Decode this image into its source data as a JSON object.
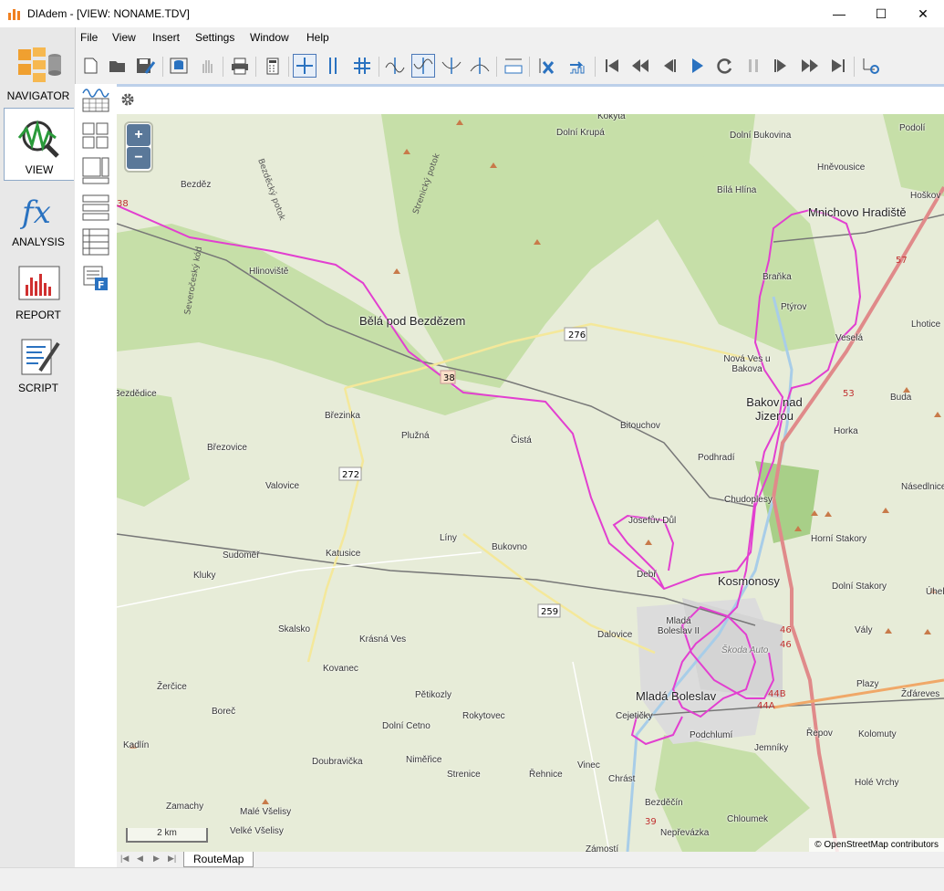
{
  "window": {
    "title": "DIAdem - [VIEW:  NONAME.TDV]",
    "minimize": "—",
    "maximize": "☐",
    "close": "✕"
  },
  "nav": [
    {
      "label": "NAVIGATOR",
      "icon": "navigator-icon"
    },
    {
      "label": "VIEW",
      "icon": "view-icon"
    },
    {
      "label": "ANALYSIS",
      "icon": "analysis-icon"
    },
    {
      "label": "REPORT",
      "icon": "report-icon"
    },
    {
      "label": "SCRIPT",
      "icon": "script-icon"
    }
  ],
  "menu": [
    "File",
    "View",
    "Insert",
    "Settings",
    "Window",
    "Help"
  ],
  "map": {
    "zoom_in": "+",
    "zoom_out": "−",
    "scale": "2 km",
    "attribution": "© OpenStreetMap contributors",
    "places": [
      {
        "name": "Kokyta"
      },
      {
        "name": "Dolní Krupá"
      },
      {
        "name": "Dolní Bukovina"
      },
      {
        "name": "Podolí"
      },
      {
        "name": "Hněvousice"
      },
      {
        "name": "Hoškov"
      },
      {
        "name": "Bílá Hlína"
      },
      {
        "name": "Bezděz"
      },
      {
        "name": "Mnichovo Hradiště"
      },
      {
        "name": "Hlinoviště"
      },
      {
        "name": "Braňka"
      },
      {
        "name": "Ptýrov"
      },
      {
        "name": "Bělá pod Bezdězem"
      },
      {
        "name": "Lhotice"
      },
      {
        "name": "Veselá"
      },
      {
        "name": "Nová Ves u Bakova"
      },
      {
        "name": "Bakov nad Jizerou"
      },
      {
        "name": "Buda"
      },
      {
        "name": "Bezdědice"
      },
      {
        "name": "Březinka"
      },
      {
        "name": "Bitouchov"
      },
      {
        "name": "Horka"
      },
      {
        "name": "Plužná"
      },
      {
        "name": "Čistá"
      },
      {
        "name": "Březovice"
      },
      {
        "name": "Podhradí"
      },
      {
        "name": "Valovice"
      },
      {
        "name": "Chudoplesy"
      },
      {
        "name": "Násedlnice"
      },
      {
        "name": "Josefův Důl"
      },
      {
        "name": "Líny"
      },
      {
        "name": "Horní Stakory"
      },
      {
        "name": "Sudoměř"
      },
      {
        "name": "Katusice"
      },
      {
        "name": "Bukovno"
      },
      {
        "name": "Kluky"
      },
      {
        "name": "Debř"
      },
      {
        "name": "Kosmonosy"
      },
      {
        "name": "Dolní Stakory"
      },
      {
        "name": "Úhel"
      },
      {
        "name": "Mladá Boleslav II"
      },
      {
        "name": "Dalovice"
      },
      {
        "name": "Skalsko"
      },
      {
        "name": "Škoda Auto"
      },
      {
        "name": "Vály"
      },
      {
        "name": "Krásná Ves"
      },
      {
        "name": "Kovanec"
      },
      {
        "name": "Plazy"
      },
      {
        "name": "Žerčice"
      },
      {
        "name": "Pětikozly"
      },
      {
        "name": "Mladá Boleslav"
      },
      {
        "name": "Žďáreves"
      },
      {
        "name": "Boreč"
      },
      {
        "name": "Rokytovec"
      },
      {
        "name": "Cejetičky"
      },
      {
        "name": "Podchlumí"
      },
      {
        "name": "Řepov"
      },
      {
        "name": "Kolomuty"
      },
      {
        "name": "Kadlín"
      },
      {
        "name": "Dolní Cetno"
      },
      {
        "name": "Jemníky"
      },
      {
        "name": "Doubravička"
      },
      {
        "name": "Niměřice"
      },
      {
        "name": "Vinec"
      },
      {
        "name": "Strenice"
      },
      {
        "name": "Řehnice"
      },
      {
        "name": "Chrást"
      },
      {
        "name": "Holé Vrchy"
      },
      {
        "name": "Zamachy"
      },
      {
        "name": "Malé Všelisy"
      },
      {
        "name": "Bezděčín"
      },
      {
        "name": "Chloumek"
      },
      {
        "name": "Velké Všelisy"
      },
      {
        "name": "Nepřevázka"
      },
      {
        "name": "Zámostí"
      },
      {
        "name": "Bezdědice"
      }
    ],
    "road_numbers": [
      "276",
      "38",
      "272",
      "259",
      "57",
      "53",
      "46",
      "46",
      "44B",
      "44A",
      "39",
      "38"
    ],
    "stream_labels": [
      "Strenický potok",
      "Severočeský kód",
      "Bezděcký potok"
    ]
  },
  "sheet_tab": "RouteMap"
}
